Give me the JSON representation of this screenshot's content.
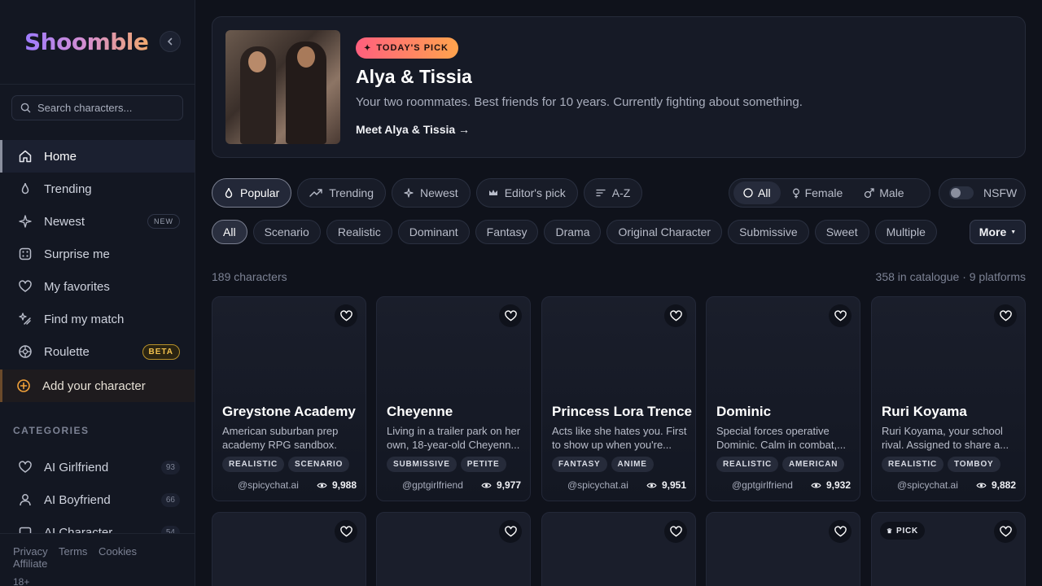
{
  "brand": {
    "logo": "Shoomble"
  },
  "search": {
    "placeholder": "Search characters..."
  },
  "nav": {
    "items": [
      {
        "label": "Home",
        "icon": "home-icon"
      },
      {
        "label": "Trending",
        "icon": "flame-icon"
      },
      {
        "label": "Newest",
        "icon": "sparkle-icon",
        "badge": "NEW"
      },
      {
        "label": "Surprise me",
        "icon": "dice-icon"
      },
      {
        "label": "My favorites",
        "icon": "heart-icon"
      },
      {
        "label": "Find my match",
        "icon": "match-icon"
      },
      {
        "label": "Roulette",
        "icon": "roulette-icon",
        "badge": "BETA"
      }
    ],
    "add_character": "Add your character"
  },
  "categories": {
    "title": "CATEGORIES",
    "items": [
      {
        "label": "AI Girlfriend",
        "count": "93"
      },
      {
        "label": "AI Boyfriend",
        "count": "66"
      },
      {
        "label": "AI Character",
        "count": "54"
      }
    ]
  },
  "footer": {
    "links": [
      "Privacy",
      "Terms",
      "Cookies",
      "Affiliate"
    ],
    "age": "18+"
  },
  "hero": {
    "badge": "TODAY'S PICK",
    "title": "Alya & Tissia",
    "description": "Your two roommates. Best friends for 10 years. Currently fighting about something.",
    "link": "Meet Alya & Tissia →"
  },
  "sort": {
    "options": [
      "Popular",
      "Trending",
      "Newest",
      "Editor's pick",
      "A-Z"
    ],
    "selected": "Popular"
  },
  "gender": {
    "options": [
      "All",
      "Female",
      "Male"
    ],
    "selected": "All"
  },
  "nsfw": {
    "label": "NSFW",
    "enabled": false
  },
  "tags": {
    "options": [
      "All",
      "Scenario",
      "Realistic",
      "Dominant",
      "Fantasy",
      "Drama",
      "Original Character",
      "Submissive",
      "Sweet",
      "Multiple"
    ],
    "selected": "All",
    "more": "More"
  },
  "results": {
    "count": "189 characters",
    "catalogue": "358 in catalogue · 9 platforms"
  },
  "cards": [
    {
      "name": "Greystone Academy",
      "description": "American suburban prep academy RPG sandbox. All...",
      "tags": [
        "REALISTIC",
        "SCENARIO"
      ],
      "source": "@spicychat.ai",
      "views": "9,988"
    },
    {
      "name": "Cheyenne",
      "description": "Living in a trailer park on her own, 18-year-old Cheyenn...",
      "tags": [
        "SUBMISSIVE",
        "PETITE"
      ],
      "source": "@gptgirlfriend",
      "views": "9,977"
    },
    {
      "name": "Princess Lora Trence",
      "description": "Acts like she hates you. First to show up when you're...",
      "tags": [
        "FANTASY",
        "ANIME"
      ],
      "source": "@spicychat.ai",
      "views": "9,951"
    },
    {
      "name": "Dominic",
      "description": "Special forces operative Dominic. Calm in combat,...",
      "tags": [
        "REALISTIC",
        "AMERICAN"
      ],
      "source": "@gptgirlfriend",
      "views": "9,932"
    },
    {
      "name": "Ruri Koyama",
      "description": "Ruri Koyama, your school rival. Assigned to share a...",
      "tags": [
        "REALISTIC",
        "TOMBOY"
      ],
      "source": "@spicychat.ai",
      "views": "9,882"
    }
  ],
  "second_row": {
    "pick_label": "PICK"
  }
}
